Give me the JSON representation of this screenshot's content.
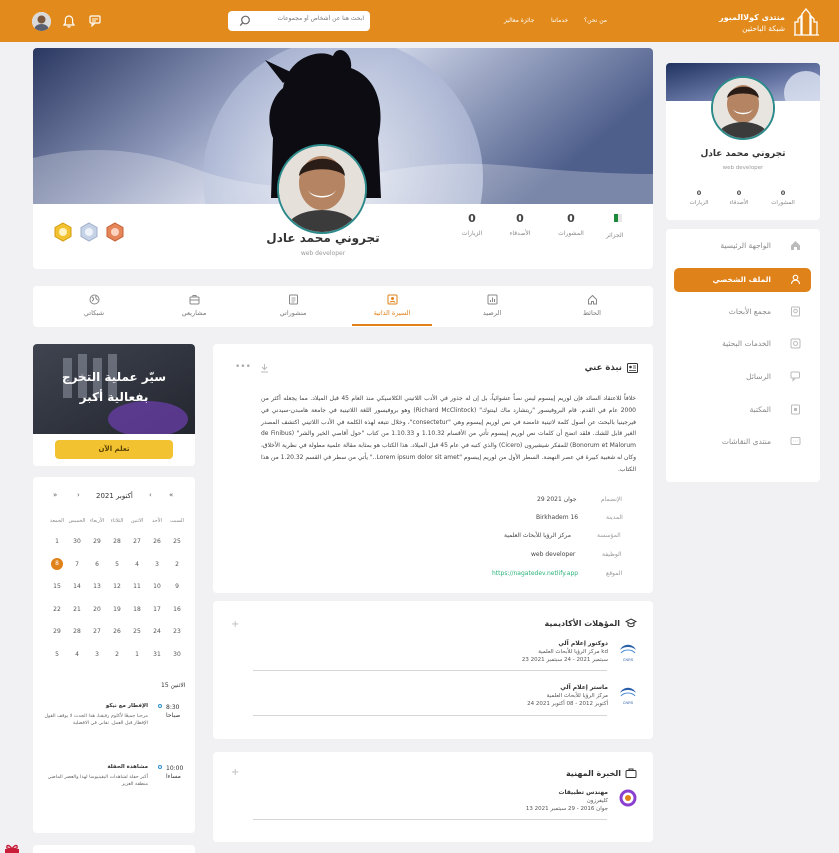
{
  "header": {
    "brand_title": "منتدى كولاالمبور",
    "brand_subtitle": "شبكة الباحثين",
    "nav": [
      "من نحن؟",
      "خدماتنا",
      "جائزة معاليز"
    ],
    "search_placeholder": "ابحث هنا عن أشخاص أو مجموعات"
  },
  "profile": {
    "name": "تجروني محمد عادل",
    "role": "web developer",
    "stats": [
      {
        "value": "0",
        "label": "المشورات"
      },
      {
        "value": "0",
        "label": "الأصدقاء"
      },
      {
        "value": "0",
        "label": "الزيارات"
      }
    ],
    "badge_label": "الجزائر"
  },
  "sidebar_profile": {
    "name": "تجروني محمد عادل",
    "role": "web developer",
    "stats": [
      {
        "value": "0",
        "label": "المشورات"
      },
      {
        "value": "0",
        "label": "الأصدقاء"
      },
      {
        "value": "0",
        "label": "الزيارات"
      }
    ]
  },
  "sidebar_menu": [
    {
      "label": "الواجهة الرئيسية",
      "icon": "home-icon",
      "active": false
    },
    {
      "label": "الملف الشخصي",
      "icon": "user-icon",
      "active": true
    },
    {
      "label": "مجمع الأبحاث",
      "icon": "research-icon",
      "active": false
    },
    {
      "label": "الخدمات البحثية",
      "icon": "services-icon",
      "active": false
    },
    {
      "label": "الرسائل",
      "icon": "messages-icon",
      "active": false
    },
    {
      "label": "المكتبة",
      "icon": "library-icon",
      "active": false
    },
    {
      "label": "منتدى النقاشات",
      "icon": "forum-icon",
      "active": false
    }
  ],
  "tabs": [
    {
      "label": "الحائط",
      "icon": "home-icon"
    },
    {
      "label": "الرصيد",
      "icon": "chart-icon"
    },
    {
      "label": "السيرة الذاتية",
      "icon": "cv-icon",
      "active": true
    },
    {
      "label": "منشوراتي",
      "icon": "document-icon"
    },
    {
      "label": "مشاريعي",
      "icon": "briefcase-icon"
    },
    {
      "label": "شبكاتي",
      "icon": "globe-icon"
    }
  ],
  "about": {
    "title": "نبذة عني",
    "text": "خلافاً للاعتقاد السائد فإن لوريم إيبسوم ليس نصاً عشوائياً، بل إن له جذور في الأدب اللاتيني الكلاسيكي منذ العام 45 قبل الميلاد. مما يجعله أكثر من 2000 عام في القدم. قام البروفيسور \"ريتشارد ماك لينتوك\" (Richard McClintock) وهو بروفيسور اللغة اللاتينية في جامعة هامبدن-سيدني في فيرجينيا بالبحث عن أصول كلمة لاتينية غامضة في نص لوريم إيبسوم وهي \"consectetur\"، وخلال تتبعه لهذه الكلمة في الأدب اللاتيني اكتشف المصدر الغير قابل للشك. فلقد اتضح أن كلمات نص لوريم إيبسوم تأتي من الأقسام 1.10.32 و 1.10.33 من كتاب \"حول أقاصي الخير والشر\" (de Finibus Bonorum et Malorum) للمفكر شيشيرون (Cicero) والذي كتبه في عام 45 قبل الميلاد. هذا الكتاب هو بمثابة مقالة علمية مطولة في نظرية الأخلاق، وكان له شعبية كبيرة في عصر النهضة. السطر الأول من لوريم إيبسوم \"Lorem ipsum dolor sit amet..\" يأتي من سطر في القسم 1.20.32 من هذا الكتاب.",
    "details": [
      {
        "label": "الإنضمام",
        "value": "29 جوان 2021"
      },
      {
        "label": "المدينة",
        "value": "Birkhadem 16"
      },
      {
        "label": "المؤسسة",
        "value": "مركز الرؤيا للأبحاث العلمية"
      },
      {
        "label": "الوظيفة",
        "value": "web developer"
      },
      {
        "label": "الموقع",
        "value": "https://nagatedev.netlify.app"
      }
    ]
  },
  "academic": {
    "title": "المؤهلات الأكاديمية",
    "items": [
      {
        "title": "دوكتور إعلام آلي",
        "org": "مركز الرؤيا للأبحاث العلمية kd",
        "date": "23 سبتمبر 2021 - 24 سبتمبر 2021",
        "logo": "CNRS"
      },
      {
        "title": "ماستر إعلام آلي",
        "org": "مركز الرؤيا للأبحاث العلمية",
        "date": "24 أكتوبر 2012 - 08 أكتوبر 2021",
        "logo": "CNRS"
      }
    ]
  },
  "experience": {
    "title": "الخبرة المهنية",
    "items": [
      {
        "title": "مهندس تطبيقات",
        "org": "كليفرزون",
        "date": "13 جوان 2016 - 29 سبتمبر 2021"
      }
    ]
  },
  "promo": {
    "line1": "سيّر عملية التخرج",
    "line2": "بفعالية أكبر",
    "button": "تعلم الآن"
  },
  "calendar": {
    "month": "أكتوبر 2021",
    "nav": [
      "«",
      "‹",
      "›",
      "»"
    ],
    "weekdays": [
      "السبت",
      "الأحد",
      "الاثنين",
      "الثلاثاء",
      "الأربعاء",
      "الخميس",
      "الجمعة"
    ],
    "weeks": [
      [
        "25",
        "26",
        "27",
        "28",
        "29",
        "30",
        "1"
      ],
      [
        "2",
        "3",
        "4",
        "5",
        "6",
        "7",
        "8"
      ],
      [
        "9",
        "10",
        "11",
        "12",
        "13",
        "14",
        "15"
      ],
      [
        "16",
        "17",
        "18",
        "19",
        "20",
        "21",
        "22"
      ],
      [
        "23",
        "24",
        "25",
        "26",
        "27",
        "28",
        "29"
      ],
      [
        "30",
        "31",
        "1",
        "2",
        "3",
        "4",
        "5"
      ]
    ],
    "selected_day": "8",
    "day_label": "الاثنين 15",
    "events": [
      {
        "time": "8:30 صباحا",
        "title": "الإفطار مع نيكو",
        "desc": "مرحبا جميعًا لأكلوم رفيقنا، هذا الحدث لا يوقف القول الإفطار قبل العمل. تفاني في الافضلية"
      },
      {
        "time": "10:00 مساءا",
        "title": "مشاهدة الحفلة",
        "desc": "أكبر حفلة لشاهدات اليقينيوسا لهذا والعصر الماضي منطقة العزيز"
      }
    ]
  },
  "colors": {
    "accent": "#e28b1c",
    "active": "#e0821a",
    "background": "#f1f1f3"
  }
}
